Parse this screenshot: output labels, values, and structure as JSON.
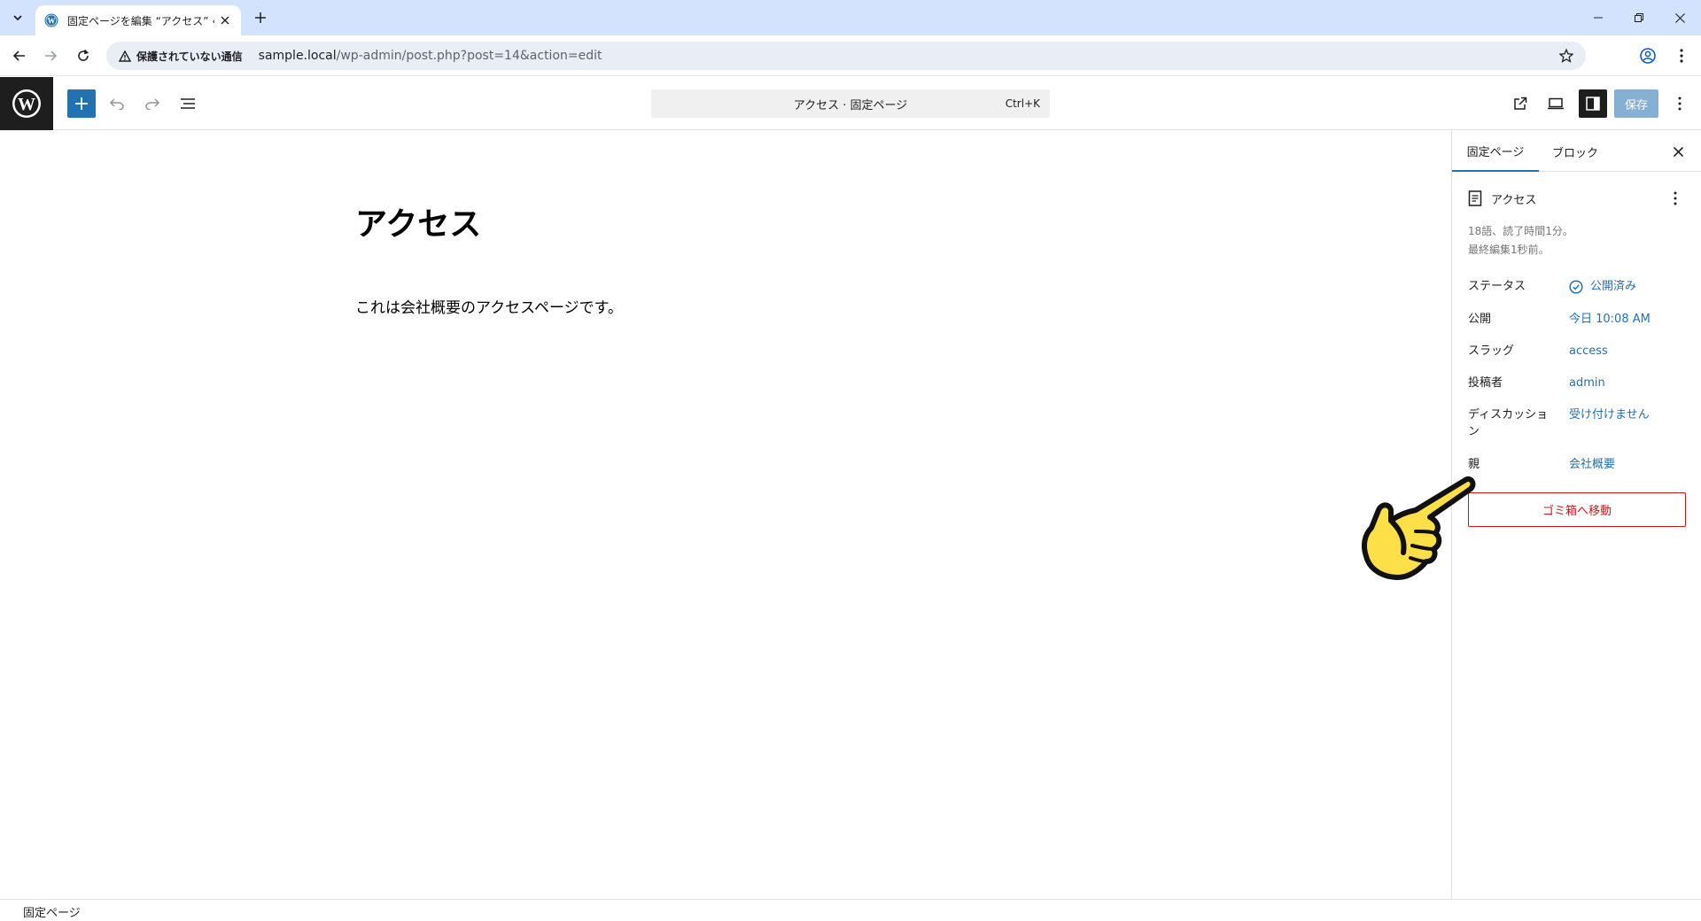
{
  "browser": {
    "tab_title": "固定ページを編集 “アクセス” ‹ sample",
    "security_label": "保護されていない通信",
    "url_host": "sample.local",
    "url_path": "/wp-admin/post.php?post=14&action=edit"
  },
  "header": {
    "command_title": "アクセス · 固定ページ",
    "command_shortcut": "Ctrl+K",
    "save_label": "保存"
  },
  "post": {
    "title": "アクセス",
    "paragraph": "これは会社概要のアクセスページです。"
  },
  "sidebar": {
    "tabs": [
      "固定ページ",
      "ブロック"
    ],
    "doc_name": "アクセス",
    "stats_line1": "18語、読了時間1分。",
    "stats_line2": "最終編集1秒前。",
    "rows": [
      {
        "label": "ステータス",
        "value": "公開済み"
      },
      {
        "label": "公開",
        "value": "今日 10:08 AM"
      },
      {
        "label": "スラッグ",
        "value": "access"
      },
      {
        "label": "投稿者",
        "value": "admin"
      },
      {
        "label": "ディスカッション",
        "value": "受け付けません"
      },
      {
        "label": "親",
        "value": "会社概要"
      }
    ],
    "trash_label": "ゴミ箱へ移動"
  },
  "footer": {
    "breadcrumb": "固定ページ"
  },
  "colors": {
    "accent": "#2271b1",
    "danger": "#cc1818",
    "tabstrip": "#d3e3fd",
    "pointer_hand": "#fde047"
  }
}
